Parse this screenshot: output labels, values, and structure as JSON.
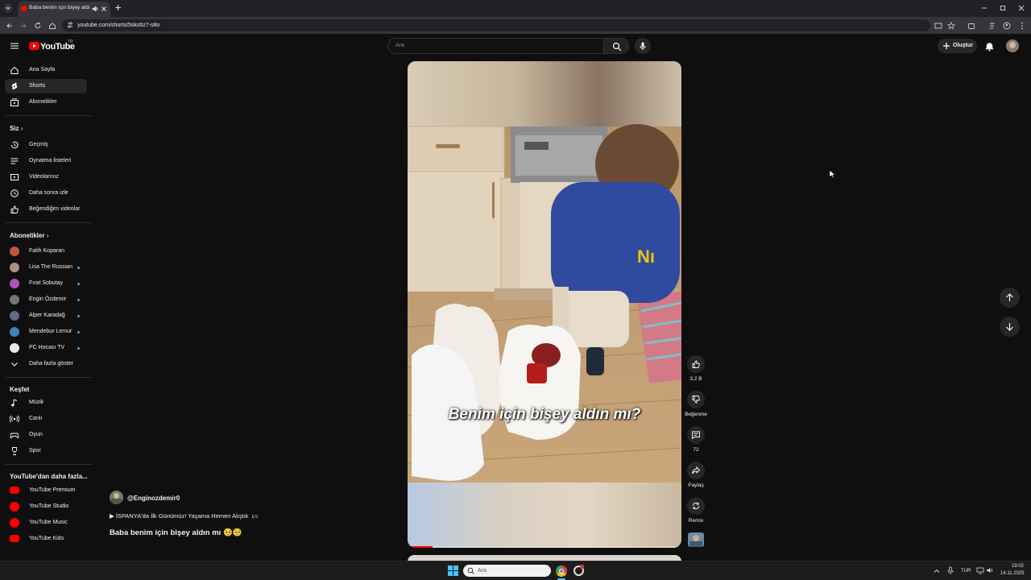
{
  "browser": {
    "tab_title": "Baba benim için bişey aldı",
    "url": "youtube.com/shorts/5sks6z7-s8o"
  },
  "masthead": {
    "logo": "YouTube",
    "country_code": "TR",
    "search_placeholder": "Ara",
    "create_label": "Oluştur"
  },
  "sidebar": {
    "main": [
      {
        "label": "Ana Sayfa",
        "icon": "home-icon"
      },
      {
        "label": "Shorts",
        "icon": "shorts-icon",
        "active": true
      },
      {
        "label": "Abonelikler",
        "icon": "subscriptions-icon"
      }
    ],
    "you_title": "Siz",
    "you": [
      {
        "label": "Geçmiş",
        "icon": "history-icon"
      },
      {
        "label": "Oynatma listeleri",
        "icon": "playlists-icon"
      },
      {
        "label": "Videolarınız",
        "icon": "your-videos-icon"
      },
      {
        "label": "Daha sonra izle",
        "icon": "watch-later-icon"
      },
      {
        "label": "Beğendiğim videolar",
        "icon": "liked-icon"
      }
    ],
    "subs_title": "Abonelikler",
    "subs": [
      {
        "label": "Fatih Koparan",
        "color": "#c0563a",
        "new": false
      },
      {
        "label": "Lisa The Russian",
        "color": "#b08f86",
        "new": true
      },
      {
        "label": "Fırat Sobutay",
        "color": "#b24fb5",
        "new": true
      },
      {
        "label": "Engin Özdemir",
        "color": "#6b7d6a",
        "new": true
      },
      {
        "label": "Alper Karadağ",
        "color": "#5e6b8a",
        "new": true
      },
      {
        "label": "Mendebur Lemur",
        "color": "#3b82c4",
        "new": true
      },
      {
        "label": "PC Hocası TV",
        "color": "#e8e8e8",
        "new": true
      }
    ],
    "show_more": "Daha fazla göster",
    "explore_title": "Keşfet",
    "explore": [
      {
        "label": "Müzik",
        "icon": "music-icon"
      },
      {
        "label": "Canlı",
        "icon": "live-icon"
      },
      {
        "label": "Oyun",
        "icon": "gaming-icon"
      },
      {
        "label": "Spor",
        "icon": "sports-icon"
      }
    ],
    "more_title": "YouTube'dan daha fazla...",
    "more": [
      {
        "label": "YouTube Premium"
      },
      {
        "label": "YouTube Studio"
      },
      {
        "label": "YouTube Music"
      },
      {
        "label": "YouTube Kids"
      }
    ]
  },
  "short": {
    "caption": "Benim için bişey aldın mı?",
    "channel": "@Enginozdemir0",
    "music_line": "▶ İSPANYA'da İlk Günümüz! Yaşama Hemen Alıştık",
    "music_suffix": "ES",
    "title": "Baba benim için bişey aldın mı 🥺🥺",
    "progress": 0.09,
    "actions": {
      "likes": "3,2 B",
      "dislike": "Beğenme",
      "comments": "72",
      "share": "Paylaş",
      "remix": "Remix"
    }
  },
  "taskbar": {
    "search_label": "Ara",
    "lang": "TUR",
    "time": "19:02",
    "date": "14.11.2025"
  },
  "colors": {
    "accent_red": "#ff0000",
    "background": "#0f0f0f",
    "new_dot": "#3ea6ff"
  }
}
